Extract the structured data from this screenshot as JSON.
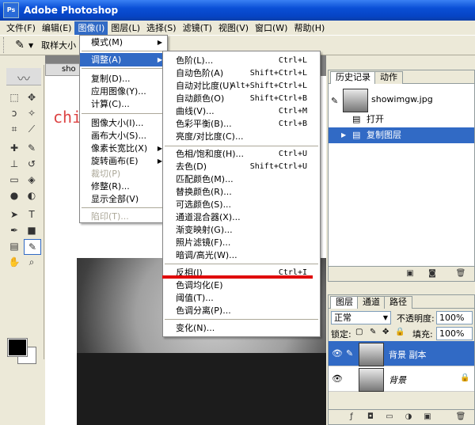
{
  "window": {
    "title": "Adobe Photoshop",
    "logo_text": "Ps"
  },
  "menubar": [
    "文件(F)",
    "编辑(E)",
    "图像(I)",
    "图层(L)",
    "选择(S)",
    "滤镜(T)",
    "视图(V)",
    "窗口(W)",
    "帮助(H)"
  ],
  "options_bar": {
    "sample_label": "取样大小"
  },
  "document": {
    "tab_title": "sho",
    "watermark": "chi"
  },
  "image_menu": {
    "items": [
      {
        "label": "模式(M)",
        "submenu": true
      },
      {
        "label": "调整(A)",
        "submenu": true,
        "highlighted": true
      },
      {
        "label": "复制(D)..."
      },
      {
        "label": "应用图像(Y)..."
      },
      {
        "label": "计算(C)..."
      },
      {
        "label": "图像大小(I)..."
      },
      {
        "label": "画布大小(S)..."
      },
      {
        "label": "像素长宽比(X)",
        "submenu": true
      },
      {
        "label": "旋转画布(E)",
        "submenu": true
      },
      {
        "label": "裁切(P)",
        "disabled": true
      },
      {
        "label": "修整(R)..."
      },
      {
        "label": "显示全部(V)"
      },
      {
        "label": "陷印(T)...",
        "disabled": true
      }
    ]
  },
  "adjust_menu": {
    "items": [
      {
        "label": "色阶(L)...",
        "shortcut": "Ctrl+L"
      },
      {
        "label": "自动色阶(A)",
        "shortcut": "Shift+Ctrl+L"
      },
      {
        "label": "自动对比度(U)",
        "shortcut": "Alt+Shift+Ctrl+L"
      },
      {
        "label": "自动颜色(O)",
        "shortcut": "Shift+Ctrl+B"
      },
      {
        "label": "曲线(V)...",
        "shortcut": "Ctrl+M"
      },
      {
        "label": "色彩平衡(B)...",
        "shortcut": "Ctrl+B"
      },
      {
        "label": "亮度/对比度(C)...",
        "shortcut": ""
      },
      {
        "label": "色相/饱和度(H)...",
        "shortcut": "Ctrl+U"
      },
      {
        "label": "去色(D)",
        "shortcut": "Shift+Ctrl+U"
      },
      {
        "label": "匹配颜色(M)...",
        "shortcut": ""
      },
      {
        "label": "替换颜色(R)...",
        "shortcut": ""
      },
      {
        "label": "可选颜色(S)...",
        "shortcut": ""
      },
      {
        "label": "通道混合器(X)...",
        "shortcut": ""
      },
      {
        "label": "渐变映射(G)...",
        "shortcut": ""
      },
      {
        "label": "照片滤镜(F)...",
        "shortcut": ""
      },
      {
        "label": "暗调/高光(W)...",
        "shortcut": ""
      },
      {
        "label": "反相(I)",
        "shortcut": "Ctrl+I"
      },
      {
        "label": "色调均化(E)",
        "shortcut": ""
      },
      {
        "label": "阈值(T)...",
        "shortcut": ""
      },
      {
        "label": "色调分离(P)...",
        "shortcut": ""
      },
      {
        "label": "变化(N)...",
        "shortcut": ""
      }
    ]
  },
  "history_panel": {
    "tabs": [
      "历史记录",
      "动作"
    ],
    "snapshot": "showimgw.jpg",
    "states": [
      {
        "label": "打开",
        "selected": false
      },
      {
        "label": "复制图层",
        "selected": true
      }
    ]
  },
  "layers_panel": {
    "tabs": [
      "图层",
      "通道",
      "路径"
    ],
    "blend_mode": "正常",
    "opacity_label": "不透明度:",
    "opacity": "100%",
    "lock_label": "锁定:",
    "fill_label": "填充:",
    "fill": "100%",
    "layers": [
      {
        "name": "背景 副本",
        "selected": true
      },
      {
        "name": "背景",
        "selected": false
      }
    ]
  },
  "colors": {
    "menu_highlight": "#316ac5",
    "annotation_red": "#e00000"
  }
}
